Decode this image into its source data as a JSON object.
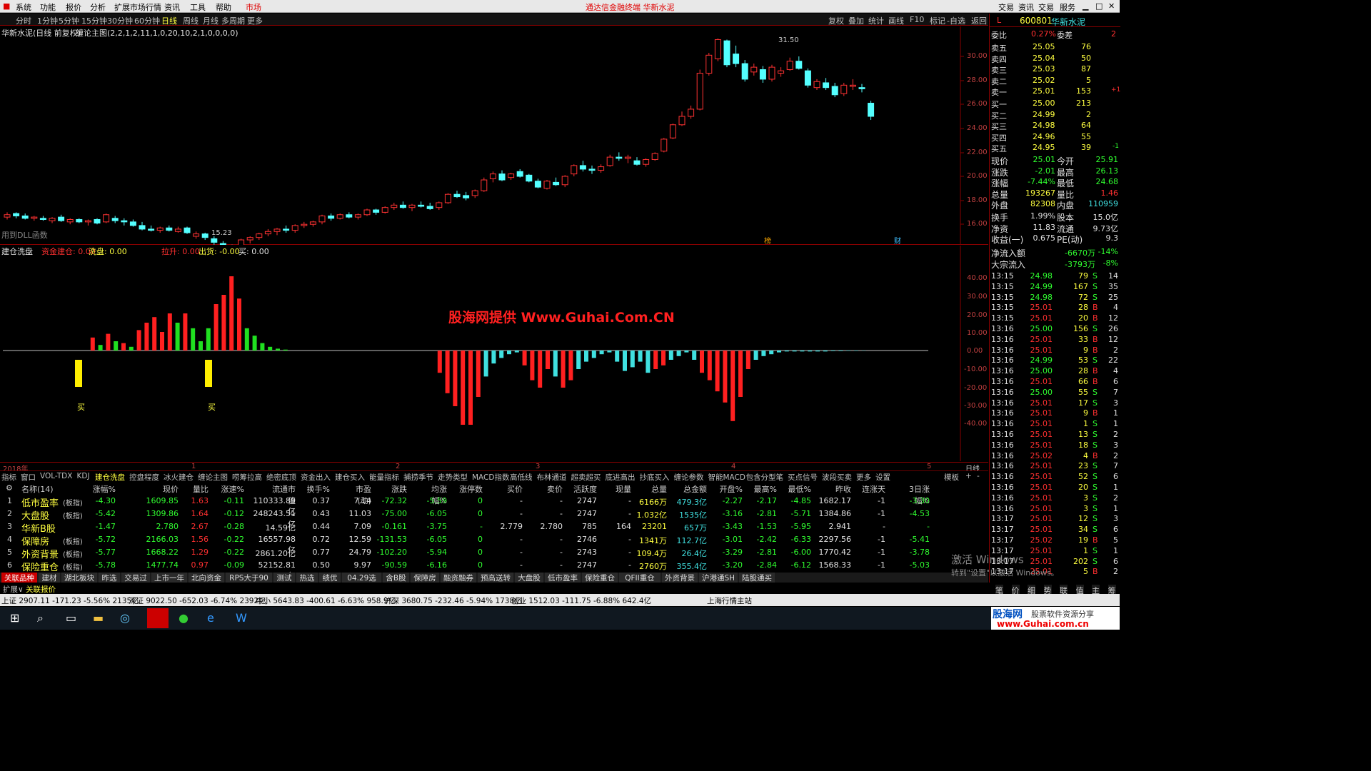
{
  "menu": [
    "系统",
    "功能",
    "报价",
    "分析",
    "扩展市场行情",
    "资讯",
    "工具",
    "帮助",
    "市场"
  ],
  "app_title": "通达信金融终端  华新水泥",
  "top_right": [
    "交易",
    "资讯",
    "交易",
    "服务"
  ],
  "periods": [
    "分时",
    "1分钟",
    "5分钟",
    "15分钟",
    "30分钟",
    "60分钟",
    "日线",
    "周线",
    "月线",
    "多周期",
    "更多"
  ],
  "toolbar_right": [
    "复权",
    "叠加",
    "统计",
    "画线",
    "F10",
    "标记",
    "-自选",
    "返回"
  ],
  "chart_title": "华新水泥(日线 前复权)",
  "chart_formula": "缠论主图(2,2,1,2,11,1,0,20,10,2,1,0,0,0,0)",
  "dll_note": "用到DLL函数",
  "high_mark": "31.50",
  "low_mark": "15.23",
  "marks": [
    "榜",
    "财"
  ],
  "price_axis": [
    "30.00",
    "28.00",
    "26.00",
    "24.00",
    "22.00",
    "20.00",
    "18.00",
    "16.00"
  ],
  "sub_title": "建仓洗盘",
  "sub_items": [
    "资金建仓: 0.00",
    "洗盘: 0.00",
    "拉升: 0.00",
    "出货: -0.00",
    "买: 0.00"
  ],
  "sub_axis": [
    "40.00",
    "30.00",
    "20.00",
    "10.00",
    "0.00",
    "-10.00",
    "-20.00",
    "-30.00",
    "-40.00"
  ],
  "buy_label": "买",
  "watermark": "股海网提供 Www.Guhai.Com.CN",
  "time_axis": [
    "2018年",
    "1",
    "2",
    "3",
    "4",
    "5"
  ],
  "time_right": "日线",
  "tabs": [
    "指标",
    "窗口",
    "VOL-TDX",
    "KDJ",
    "建仓洗盘",
    "控盘程度",
    "冰火建仓",
    "缠论主图",
    "唠筹拉高",
    "绝密底顶",
    "资金出入",
    "建仓买入",
    "能量指标",
    "捕捞季节",
    "走势类型",
    "MACD指数",
    "高低线",
    "布林通道",
    "超卖超买",
    "底进高出",
    "抄底买入",
    "缠论参数",
    "智能MACD",
    "包含分型笔",
    "买点信号",
    "波段买卖",
    "更多",
    "设置"
  ],
  "tab_right": [
    "模板",
    "+",
    "-"
  ],
  "table": {
    "headers": [
      "名称(14)",
      "涨幅%",
      "现价",
      "量比",
      "涨速%",
      "流通市值",
      "换手%",
      "市盈(动)",
      "涨跌",
      "均涨幅%",
      "涨停数",
      "买价",
      "卖价",
      "活跃度",
      "现量",
      "总量",
      "总金额",
      "开盘%",
      "最高%",
      "最低%",
      "昨收",
      "连涨天",
      "3日涨幅%"
    ],
    "rows": [
      [
        "1",
        "低市盈率",
        "(板指)",
        "-4.30",
        "1609.85",
        "1.63",
        "-0.11",
        "110333.89亿",
        "0.37",
        "7.14",
        "-72.32",
        "-5.59",
        "0",
        "-",
        "-",
        "2747",
        "-",
        "6166万",
        "479.3亿",
        "-2.27",
        "-2.17",
        "-4.85",
        "1682.17",
        "-1",
        "-3.30"
      ],
      [
        "2",
        "大盘股",
        "(板指)",
        "-5.42",
        "1309.86",
        "1.64",
        "-0.12",
        "248243.51亿",
        "0.43",
        "11.03",
        "-75.00",
        "-6.05",
        "0",
        "-",
        "-",
        "2747",
        "-",
        "1.032亿",
        "1535亿",
        "-3.16",
        "-2.81",
        "-5.71",
        "1384.86",
        "-1",
        "-4.53"
      ],
      [
        "3",
        "华新B股",
        "",
        "-1.47",
        "2.780",
        "2.67",
        "-0.28",
        "14.59亿",
        "0.44",
        "7.09",
        "-0.161",
        "-3.75",
        "-",
        "2.779",
        "2.780",
        "785",
        "164",
        "23201",
        "657万",
        "-3.43",
        "-1.53",
        "-5.95",
        "2.941",
        "-",
        "-"
      ],
      [
        "4",
        "保障房",
        "(板指)",
        "-5.72",
        "2166.03",
        "1.56",
        "-0.22",
        "16557.98亿",
        "0.72",
        "12.59",
        "-131.53",
        "-6.05",
        "0",
        "-",
        "-",
        "2746",
        "-",
        "1341万",
        "112.7亿",
        "-3.01",
        "-2.42",
        "-6.33",
        "2297.56",
        "-1",
        "-5.41"
      ],
      [
        "5",
        "外资背景",
        "(板指)",
        "-5.77",
        "1668.22",
        "1.29",
        "-0.22",
        "2861.20亿",
        "0.77",
        "24.79",
        "-102.20",
        "-5.94",
        "0",
        "-",
        "-",
        "2743",
        "-",
        "109.4万",
        "26.4亿",
        "-3.29",
        "-2.81",
        "-6.00",
        "1770.42",
        "-1",
        "-3.78"
      ],
      [
        "6",
        "保险重仓",
        "(板指)",
        "-5.78",
        "1477.74",
        "0.97",
        "-0.09",
        "52152.81亿",
        "0.50",
        "9.97",
        "-90.59",
        "-6.16",
        "0",
        "-",
        "-",
        "2747",
        "-",
        "2760万",
        "355.4亿",
        "-3.20",
        "-2.84",
        "-6.12",
        "1568.33",
        "-1",
        "-5.03"
      ]
    ]
  },
  "sectors": [
    "关联品种",
    "建材",
    "湖北板块",
    "昨选",
    "交易过",
    "上市一年",
    "北向资金",
    "RPS大于90",
    "测试",
    "热选",
    "绩优",
    "04.29选",
    "含B股",
    "保障房",
    "融资融券",
    "预高送转",
    "大盘股",
    "低市盈率",
    "保险重仓",
    "QFII重仓",
    "外资背景",
    "沪港通SH",
    "陆股通买"
  ],
  "bottom_tabs": [
    "扩展∨",
    "关联报价"
  ],
  "status": [
    "上证 2907.11 -171.23 -5.56% 2135亿",
    "深证 9022.50 -652.03 -6.74% 2392亿",
    "中小 5643.83 -400.61 -6.63% 958.9亿",
    "沪深 3680.75 -232.46 -5.94% 1738亿",
    "创业 1512.03 -111.75 -6.88% 642.4亿",
    "上海行情主站"
  ],
  "quote": {
    "code": "600801",
    "name": "华新水泥",
    "weibi": [
      "委比",
      "0.27%",
      "委差",
      "2"
    ],
    "asks": [
      [
        "卖五",
        "25.05",
        "76"
      ],
      [
        "卖四",
        "25.04",
        "50"
      ],
      [
        "卖三",
        "25.03",
        "87"
      ],
      [
        "卖二",
        "25.02",
        "5"
      ],
      [
        "卖一",
        "25.01",
        "153"
      ]
    ],
    "ask1_extra": "+1",
    "bids": [
      [
        "买一",
        "25.00",
        "213"
      ],
      [
        "买二",
        "24.99",
        "2"
      ],
      [
        "买三",
        "24.98",
        "64"
      ],
      [
        "买四",
        "24.96",
        "55"
      ],
      [
        "买五",
        "24.95",
        "39"
      ]
    ],
    "bid5_extra": "-1",
    "stats": [
      [
        "现价",
        "25.01",
        "今开",
        "25.91"
      ],
      [
        "涨跌",
        "-2.01",
        "最高",
        "26.13"
      ],
      [
        "涨幅",
        "-7.44%",
        "最低",
        "24.68"
      ],
      [
        "总量",
        "193267",
        "量比",
        "1.46"
      ],
      [
        "外盘",
        "82308",
        "内盘",
        "110959"
      ]
    ],
    "stats2": [
      [
        "换手",
        "1.99%",
        "股本",
        "15.0亿"
      ],
      [
        "净资",
        "11.83",
        "流通",
        "9.73亿"
      ],
      [
        "收益(一)",
        "0.675",
        "PE(动)",
        "9.3"
      ]
    ],
    "flow": [
      [
        "净流入额",
        "-6670万",
        "-14%"
      ],
      [
        "大宗流入",
        "-3793万",
        "-8%"
      ]
    ],
    "ticks": [
      [
        "13:15",
        "24.98",
        "79",
        "S",
        "14"
      ],
      [
        "13:15",
        "24.99",
        "167",
        "S",
        "35"
      ],
      [
        "13:15",
        "24.98",
        "72",
        "S",
        "25"
      ],
      [
        "13:15",
        "25.01",
        "28",
        "B",
        "4"
      ],
      [
        "13:15",
        "25.01",
        "20",
        "B",
        "12"
      ],
      [
        "13:16",
        "25.00",
        "156",
        "S",
        "26"
      ],
      [
        "13:16",
        "25.01",
        "33",
        "B",
        "12"
      ],
      [
        "13:16",
        "25.01",
        "9",
        "B",
        "2"
      ],
      [
        "13:16",
        "24.99",
        "53",
        "S",
        "22"
      ],
      [
        "13:16",
        "25.00",
        "28",
        "B",
        "4"
      ],
      [
        "13:16",
        "25.01",
        "66",
        "B",
        "6"
      ],
      [
        "13:16",
        "25.00",
        "55",
        "S",
        "7"
      ],
      [
        "13:16",
        "25.01",
        "17",
        "S",
        "3"
      ],
      [
        "13:16",
        "25.01",
        "9",
        "B",
        "1"
      ],
      [
        "13:16",
        "25.01",
        "1",
        "S",
        "1"
      ],
      [
        "13:16",
        "25.01",
        "13",
        "S",
        "2"
      ],
      [
        "13:16",
        "25.01",
        "18",
        "S",
        "3"
      ],
      [
        "13:16",
        "25.02",
        "4",
        "B",
        "2"
      ],
      [
        "13:16",
        "25.01",
        "23",
        "S",
        "7"
      ],
      [
        "13:16",
        "25.01",
        "52",
        "S",
        "6"
      ],
      [
        "13:16",
        "25.01",
        "20",
        "S",
        "1"
      ],
      [
        "13:16",
        "25.01",
        "3",
        "S",
        "2"
      ],
      [
        "13:16",
        "25.01",
        "3",
        "S",
        "1"
      ],
      [
        "13:17",
        "25.01",
        "12",
        "S",
        "3"
      ],
      [
        "13:17",
        "25.01",
        "34",
        "S",
        "6"
      ],
      [
        "13:17",
        "25.02",
        "19",
        "B",
        "5"
      ],
      [
        "13:17",
        "25.01",
        "1",
        "S",
        "1"
      ],
      [
        "13:17",
        "25.01",
        "202",
        "S",
        "6"
      ],
      [
        "13:17",
        "25.01",
        "5",
        "B",
        "2"
      ]
    ],
    "bottom_tabs": [
      "笔",
      "价",
      "细",
      "势",
      "联",
      "值",
      "主",
      "筹"
    ]
  },
  "activation": [
    "激活 Windows",
    "转到\"设置\"以激活 Windows。"
  ],
  "brand": [
    "股海网",
    "股票软件资源分享",
    "www.Guhai.com.cn"
  ],
  "candles": [
    [
      16.6,
      17.0,
      16.4,
      16.8
    ],
    [
      16.9,
      17.0,
      16.5,
      16.7
    ],
    [
      16.7,
      16.9,
      16.4,
      16.5
    ],
    [
      16.5,
      16.7,
      16.3,
      16.6
    ],
    [
      16.5,
      16.7,
      16.3,
      16.4
    ],
    [
      16.3,
      16.6,
      16.1,
      16.5
    ],
    [
      16.6,
      16.8,
      16.2,
      16.3
    ],
    [
      16.2,
      16.5,
      16.0,
      16.4
    ],
    [
      16.4,
      16.5,
      16.1,
      16.2
    ],
    [
      16.2,
      16.4,
      15.9,
      16.3
    ],
    [
      16.4,
      16.5,
      16.0,
      16.1
    ],
    [
      16.2,
      16.9,
      16.1,
      16.8
    ],
    [
      16.5,
      16.7,
      16.1,
      16.3
    ],
    [
      16.3,
      16.5,
      15.9,
      16.2
    ],
    [
      16.2,
      16.4,
      15.8,
      15.9
    ],
    [
      15.9,
      16.2,
      15.5,
      15.6
    ],
    [
      15.6,
      15.9,
      15.4,
      15.5
    ],
    [
      15.5,
      15.8,
      15.3,
      15.7
    ],
    [
      15.7,
      15.9,
      15.4,
      15.5
    ],
    [
      15.4,
      15.8,
      15.3,
      15.6
    ],
    [
      15.7,
      15.8,
      15.2,
      15.3
    ],
    [
      15.0,
      15.4,
      14.8,
      15.2
    ],
    [
      15.2,
      15.3,
      14.7,
      14.9
    ],
    [
      14.8,
      15.0,
      14.3,
      14.5
    ],
    [
      14.4,
      14.6,
      13.9,
      14.1
    ],
    [
      14.0,
      14.3,
      13.6,
      13.7
    ],
    [
      14.2,
      14.8,
      14.0,
      14.7
    ],
    [
      14.7,
      15.0,
      14.4,
      14.9
    ],
    [
      14.9,
      15.3,
      14.7,
      15.2
    ],
    [
      15.2,
      15.6,
      15.0,
      15.4
    ],
    [
      15.4,
      15.7,
      15.1,
      15.6
    ],
    [
      15.6,
      15.9,
      15.3,
      15.5
    ],
    [
      15.5,
      16.0,
      15.3,
      15.9
    ],
    [
      15.9,
      16.2,
      15.7,
      16.0
    ],
    [
      16.0,
      16.3,
      15.8,
      16.2
    ],
    [
      16.2,
      16.8,
      16.0,
      16.7
    ],
    [
      16.7,
      16.9,
      16.3,
      16.5
    ],
    [
      16.5,
      16.9,
      16.4,
      16.8
    ],
    [
      16.8,
      17.0,
      16.5,
      16.6
    ],
    [
      16.6,
      16.9,
      16.4,
      16.8
    ],
    [
      16.8,
      17.3,
      16.7,
      17.2
    ],
    [
      17.2,
      17.3,
      16.8,
      17.0
    ],
    [
      17.0,
      17.5,
      16.9,
      17.4
    ],
    [
      17.4,
      17.8,
      17.2,
      17.6
    ],
    [
      17.6,
      17.9,
      17.3,
      17.4
    ],
    [
      17.4,
      17.7,
      17.1,
      17.6
    ],
    [
      17.6,
      17.9,
      17.4,
      17.5
    ],
    [
      17.5,
      17.8,
      17.2,
      17.3
    ],
    [
      17.4,
      17.9,
      17.2,
      17.8
    ],
    [
      17.8,
      18.6,
      17.7,
      18.5
    ],
    [
      18.5,
      18.8,
      18.2,
      18.3
    ],
    [
      18.4,
      18.7,
      18.0,
      18.2
    ],
    [
      18.4,
      18.9,
      18.2,
      18.8
    ],
    [
      18.8,
      19.9,
      18.7,
      19.7
    ],
    [
      19.8,
      20.4,
      19.5,
      20.2
    ],
    [
      20.2,
      20.5,
      19.6,
      19.7
    ],
    [
      19.9,
      20.3,
      19.7,
      20.2
    ],
    [
      20.4,
      20.6,
      19.9,
      20.0
    ],
    [
      20.1,
      20.2,
      19.5,
      19.6
    ],
    [
      19.6,
      19.8,
      19.0,
      19.1
    ],
    [
      19.0,
      19.7,
      18.9,
      19.6
    ],
    [
      19.5,
      19.9,
      19.2,
      19.3
    ],
    [
      19.3,
      20.1,
      19.1,
      20.0
    ],
    [
      20.2,
      21.0,
      20.0,
      20.9
    ],
    [
      20.9,
      21.3,
      20.4,
      20.6
    ],
    [
      20.6,
      20.9,
      20.2,
      20.5
    ],
    [
      20.5,
      21.0,
      20.3,
      20.8
    ],
    [
      20.9,
      21.8,
      20.8,
      21.6
    ],
    [
      21.6,
      22.0,
      21.3,
      21.5
    ],
    [
      21.5,
      21.8,
      21.1,
      21.6
    ],
    [
      21.3,
      21.6,
      20.9,
      21.0
    ],
    [
      21.0,
      21.5,
      20.8,
      21.4
    ],
    [
      21.4,
      22.0,
      21.3,
      21.9
    ],
    [
      22.1,
      23.2,
      22.0,
      23.1
    ],
    [
      23.2,
      24.4,
      23.1,
      24.3
    ],
    [
      24.3,
      25.4,
      24.2,
      25.0
    ],
    [
      25.0,
      25.9,
      24.8,
      25.6
    ],
    [
      25.6,
      28.9,
      25.5,
      28.6
    ],
    [
      28.6,
      30.3,
      28.4,
      30.1
    ],
    [
      29.8,
      31.5,
      29.6,
      31.4
    ],
    [
      31.3,
      31.4,
      29.1,
      29.3
    ],
    [
      30.2,
      30.9,
      29.1,
      29.4
    ],
    [
      29.4,
      29.7,
      27.9,
      28.1
    ],
    [
      28.7,
      29.4,
      28.4,
      29.1
    ],
    [
      28.9,
      29.2,
      27.8,
      28.1
    ],
    [
      28.1,
      29.3,
      27.9,
      29.1
    ],
    [
      28.6,
      29.1,
      28.3,
      28.8
    ],
    [
      28.9,
      29.9,
      28.8,
      29.6
    ],
    [
      29.6,
      30.0,
      28.9,
      29.0
    ],
    [
      28.8,
      29.0,
      27.4,
      27.6
    ],
    [
      27.4,
      28.1,
      27.2,
      27.9
    ],
    [
      27.8,
      28.2,
      27.2,
      27.4
    ],
    [
      27.5,
      27.8,
      26.6,
      26.8
    ],
    [
      26.9,
      27.8,
      26.7,
      27.6
    ],
    [
      27.5,
      28.1,
      27.2,
      27.6
    ],
    [
      27.4,
      27.7,
      27.0,
      27.3
    ],
    [
      26.1,
      26.3,
      24.7,
      25.0
    ]
  ],
  "sub_bars": [
    [
      0,
      0,
      0
    ],
    [
      0,
      0,
      0
    ],
    [
      0,
      0,
      0
    ],
    [
      0,
      0,
      0
    ],
    [
      0,
      0,
      0
    ],
    [
      0,
      0,
      0
    ],
    [
      0,
      0,
      0
    ],
    [
      0,
      0,
      0
    ],
    [
      0,
      0,
      0
    ],
    [
      0,
      0,
      0
    ],
    [
      0,
      0,
      0
    ],
    [
      7,
      1,
      0
    ],
    [
      3,
      1,
      0
    ],
    [
      9,
      1,
      0
    ],
    [
      5,
      1,
      0
    ],
    [
      4,
      1,
      0
    ],
    [
      2,
      1,
      0
    ],
    [
      11,
      1,
      0
    ],
    [
      15,
      1,
      0
    ],
    [
      18,
      1,
      0
    ],
    [
      10,
      1,
      0
    ],
    [
      20,
      1,
      0
    ],
    [
      15,
      1,
      0
    ],
    [
      20,
      1,
      0
    ],
    [
      12,
      1,
      0
    ],
    [
      5,
      1,
      0
    ],
    [
      12,
      1,
      0
    ],
    [
      25,
      1,
      0
    ],
    [
      30,
      1,
      0
    ],
    [
      40,
      1,
      0
    ],
    [
      28,
      1,
      0
    ],
    [
      12,
      1,
      0
    ],
    [
      8,
      1,
      0
    ],
    [
      4,
      1,
      0
    ],
    [
      2,
      1,
      0
    ],
    [
      1,
      1,
      0
    ],
    [
      0.5,
      1,
      0
    ],
    [
      0,
      0,
      0
    ],
    [
      0,
      0,
      0
    ],
    [
      0,
      0,
      0
    ],
    [
      0,
      0,
      0
    ],
    [
      0,
      0,
      0
    ],
    [
      0,
      0,
      0
    ],
    [
      0,
      0,
      0
    ],
    [
      0,
      0,
      0
    ],
    [
      0,
      0,
      0
    ],
    [
      0,
      0,
      0
    ],
    [
      0,
      0,
      0
    ],
    [
      0,
      0,
      0
    ],
    [
      0,
      0,
      0
    ],
    [
      0,
      0,
      0
    ],
    [
      0,
      0,
      0
    ],
    [
      0,
      0,
      0
    ],
    [
      0,
      0,
      0
    ],
    [
      0,
      0,
      0
    ],
    [
      0,
      0,
      0
    ],
    [
      -12,
      0,
      0
    ],
    [
      -23,
      0,
      0
    ],
    [
      -30,
      0,
      0
    ],
    [
      -40,
      0,
      0
    ],
    [
      -40,
      0,
      0
    ],
    [
      -25,
      0,
      0
    ],
    [
      -14,
      0,
      0
    ],
    [
      -7,
      0,
      0
    ],
    [
      -4,
      0,
      0
    ],
    [
      -2,
      0,
      0
    ],
    [
      -1,
      0,
      0
    ],
    [
      -8,
      0,
      0
    ],
    [
      -16,
      0,
      0
    ],
    [
      -20,
      0,
      0
    ],
    [
      -10,
      0,
      0
    ],
    [
      -14,
      0,
      0
    ],
    [
      -20,
      0,
      0
    ],
    [
      -16,
      0,
      0
    ],
    [
      -10,
      0,
      0
    ],
    [
      -6,
      0,
      0
    ],
    [
      -4,
      0,
      0
    ],
    [
      -2,
      0,
      0
    ],
    [
      -1,
      0,
      0
    ],
    [
      -6,
      0,
      0
    ],
    [
      -11,
      0,
      0
    ],
    [
      -9,
      0,
      0
    ],
    [
      -6,
      0,
      0
    ],
    [
      -12,
      0,
      0
    ],
    [
      -10,
      0,
      0
    ],
    [
      -8,
      0,
      0
    ],
    [
      -5,
      0,
      0
    ],
    [
      -3,
      0,
      0
    ],
    [
      -1,
      0,
      0
    ],
    [
      -5,
      0,
      0
    ],
    [
      -12,
      0,
      0
    ],
    [
      -16,
      0,
      0
    ],
    [
      -22,
      0,
      0
    ],
    [
      -28,
      0,
      0
    ],
    [
      -38,
      0,
      0
    ],
    [
      -25,
      0,
      0
    ],
    [
      -10,
      0,
      0
    ],
    [
      -5,
      0,
      0
    ],
    [
      -3,
      0,
      0
    ],
    [
      -2,
      0,
      0
    ],
    [
      -1,
      0,
      0
    ],
    [
      -0.5,
      0,
      0
    ],
    [
      -0.5,
      0,
      0
    ],
    [
      -0.5,
      0,
      0
    ],
    [
      -0.5,
      0,
      0
    ],
    [
      -0.5,
      0,
      0
    ],
    [
      -0.5,
      0,
      0
    ],
    [
      -0.3,
      0,
      0
    ],
    [
      -0.3,
      0,
      0
    ],
    [
      -0.2,
      0,
      0
    ],
    [
      -0.2,
      0,
      0
    ],
    [
      -0.1,
      0,
      0
    ]
  ]
}
